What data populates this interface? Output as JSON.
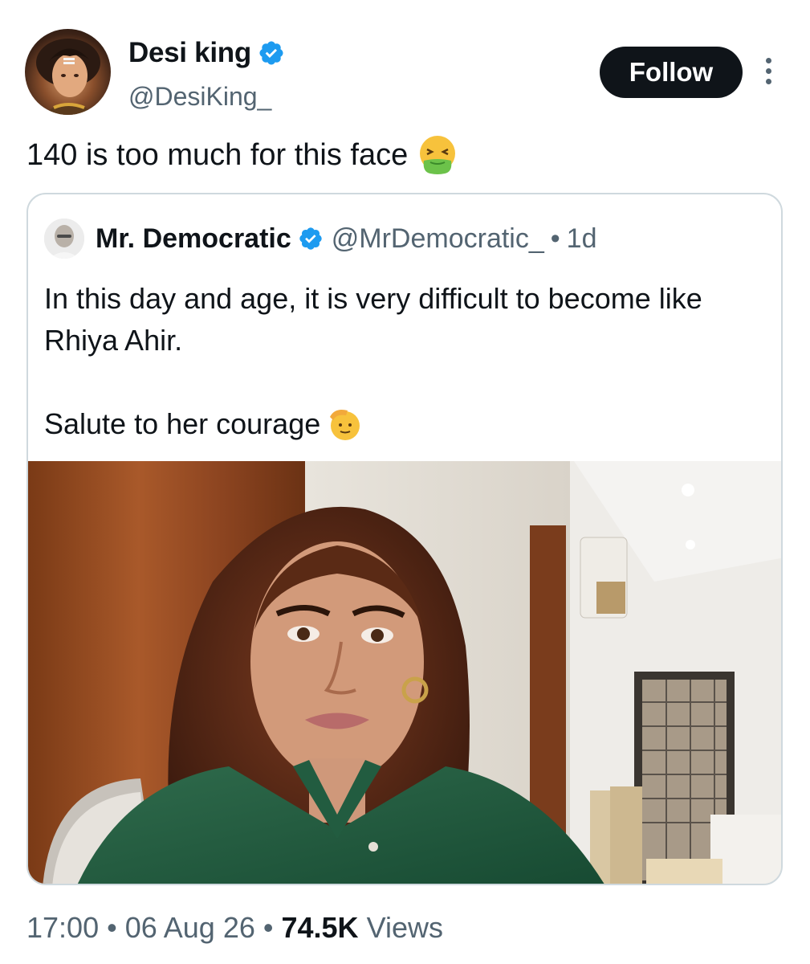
{
  "author": {
    "display_name": "Desi king",
    "handle": "@DesiKing_",
    "verified": true,
    "follow_label": "Follow"
  },
  "tweet": {
    "text": "140 is too much for this face",
    "emoji": "nauseated-vomiting-face"
  },
  "quoted_tweet": {
    "display_name": "Mr. Democratic",
    "handle": "@MrDemocratic_",
    "separator": "•",
    "age": "1d",
    "line1": "In this day and age, it is very difficult to become like Rhiya Ahir.",
    "line2": "Salute to her courage",
    "emoji": "saluting-face",
    "media": "photo"
  },
  "meta": {
    "time": "17:00",
    "date": "06 Aug 26",
    "views_count": "74.5K",
    "views_label": "Views",
    "separator": "•"
  },
  "colors": {
    "verified_blue": "#1d9bf0",
    "text_primary": "#0f1419",
    "text_secondary": "#536471",
    "border": "#cfd9de"
  }
}
